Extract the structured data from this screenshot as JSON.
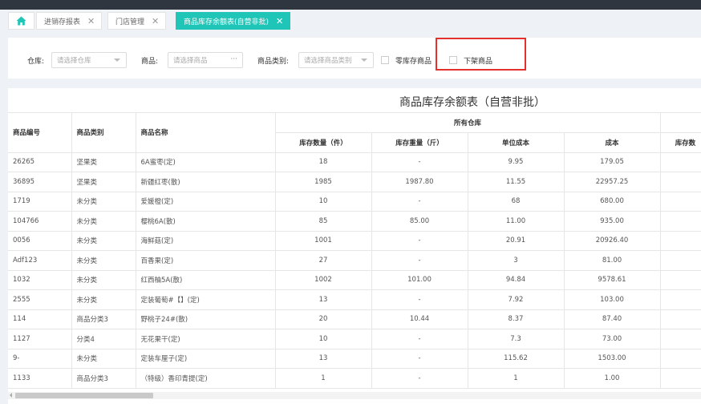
{
  "tabs": [
    {
      "label": "进销存报表"
    },
    {
      "label": "门店管理"
    },
    {
      "label": "商品库存余额表(自营非批)"
    }
  ],
  "filters": {
    "warehouse_label": "仓库:",
    "warehouse_placeholder": "请选择仓库",
    "product_label": "商品:",
    "product_placeholder": "请选择商品",
    "category_label": "商品类别:",
    "category_placeholder": "请选择商品类别",
    "zero_stock_label": "零库存商品",
    "delisted_label": "下架商品"
  },
  "report": {
    "title": "商品库存余额表（自营非批）",
    "group_header": "所有仓库",
    "columns": {
      "code": "商品编号",
      "category": "商品类别",
      "name": "商品名称",
      "qty": "库存数量（件）",
      "weight": "库存重量（斤）",
      "unit_cost": "单位成本",
      "cost": "成本",
      "next_cut": "库存数"
    },
    "rows": [
      {
        "code": "26265",
        "category": "坚果类",
        "name": "6A蜜枣(定)",
        "qty": "18",
        "weight": "-",
        "unit_cost": "9.95",
        "cost": "179.05"
      },
      {
        "code": "36895",
        "category": "坚果类",
        "name": "新疆红枣(散)",
        "qty": "1985",
        "weight": "1987.80",
        "unit_cost": "11.55",
        "cost": "22957.25"
      },
      {
        "code": "1719",
        "category": "未分类",
        "name": "爱媛橙(定)",
        "qty": "10",
        "weight": "-",
        "unit_cost": "68",
        "cost": "680.00"
      },
      {
        "code": "104766",
        "category": "未分类",
        "name": "樱桃6A(散)",
        "qty": "85",
        "weight": "85.00",
        "unit_cost": "11.00",
        "cost": "935.00"
      },
      {
        "code": "0056",
        "category": "未分类",
        "name": "海鲜菇(定)",
        "qty": "1001",
        "weight": "-",
        "unit_cost": "20.91",
        "cost": "20926.40"
      },
      {
        "code": "Adf123",
        "category": "未分类",
        "name": "百香果(定)",
        "qty": "27",
        "weight": "-",
        "unit_cost": "3",
        "cost": "81.00"
      },
      {
        "code": "1032",
        "category": "未分类",
        "name": "红西柚5A(散)",
        "qty": "1002",
        "weight": "101.00",
        "unit_cost": "94.84",
        "cost": "9578.61"
      },
      {
        "code": "2555",
        "category": "未分类",
        "name": "定装葡萄#【】(定)",
        "qty": "13",
        "weight": "-",
        "unit_cost": "7.92",
        "cost": "103.00"
      },
      {
        "code": "114",
        "category": "商品分类3",
        "name": "野桃子24#(散)",
        "qty": "20",
        "weight": "10.44",
        "unit_cost": "8.37",
        "cost": "87.40"
      },
      {
        "code": "1127",
        "category": "分类4",
        "name": "无花果干(定)",
        "qty": "10",
        "weight": "-",
        "unit_cost": "7.3",
        "cost": "73.00"
      },
      {
        "code": "9-",
        "category": "未分类",
        "name": "定装车厘子(定)",
        "qty": "13",
        "weight": "-",
        "unit_cost": "115.62",
        "cost": "1503.00"
      },
      {
        "code": "1133",
        "category": "商品分类3",
        "name": "（特级）香印青提(定)",
        "qty": "1",
        "weight": "-",
        "unit_cost": "1",
        "cost": "1.00"
      }
    ]
  },
  "colors": {
    "accent": "#1fc5b7",
    "highlight_border": "#e3312d",
    "topbar": "#2f3640"
  }
}
